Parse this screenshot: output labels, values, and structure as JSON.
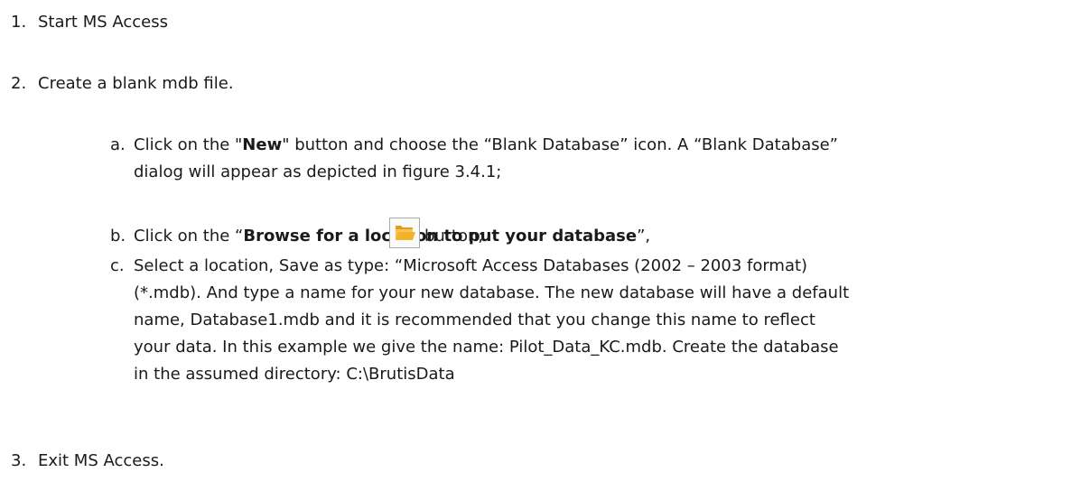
{
  "steps": [
    {
      "num": "1.",
      "text": "Start MS Access"
    },
    {
      "num": "2.",
      "text": "Create a blank mdb file."
    },
    {
      "num": "3.",
      "text": "Exit MS Access."
    }
  ],
  "substeps": {
    "a": {
      "letter": "a.",
      "pre": "Click on the \"",
      "bold": "New",
      "post": "\" button and choose the “Blank Database” icon. A “Blank Database”",
      "line2": "dialog will appear as depicted in figure 3.4.1;"
    },
    "b": {
      "letter": "b.",
      "pre": "Click on the “",
      "bold": "Browse for a location to put your database",
      "post": "”,",
      "after_icon": "button;",
      "icon": "folder-open-icon"
    },
    "c": {
      "letter": "c.",
      "line1": "Select a location, Save as type: “Microsoft Access Databases (2002 – 2003 format)",
      "line2": "(*.mdb). And type a name for your new database. The new database will have a default",
      "line3": "name, Database1.mdb and it is recommended that you change this name to reflect",
      "line4": "your data. In this example we give the name: Pilot_Data_KC.mdb. Create the database",
      "line5": "in the assumed directory: C:\\BrutisData"
    }
  },
  "colors": {
    "text": "#1a1a1a",
    "folder": "#f0b429"
  }
}
